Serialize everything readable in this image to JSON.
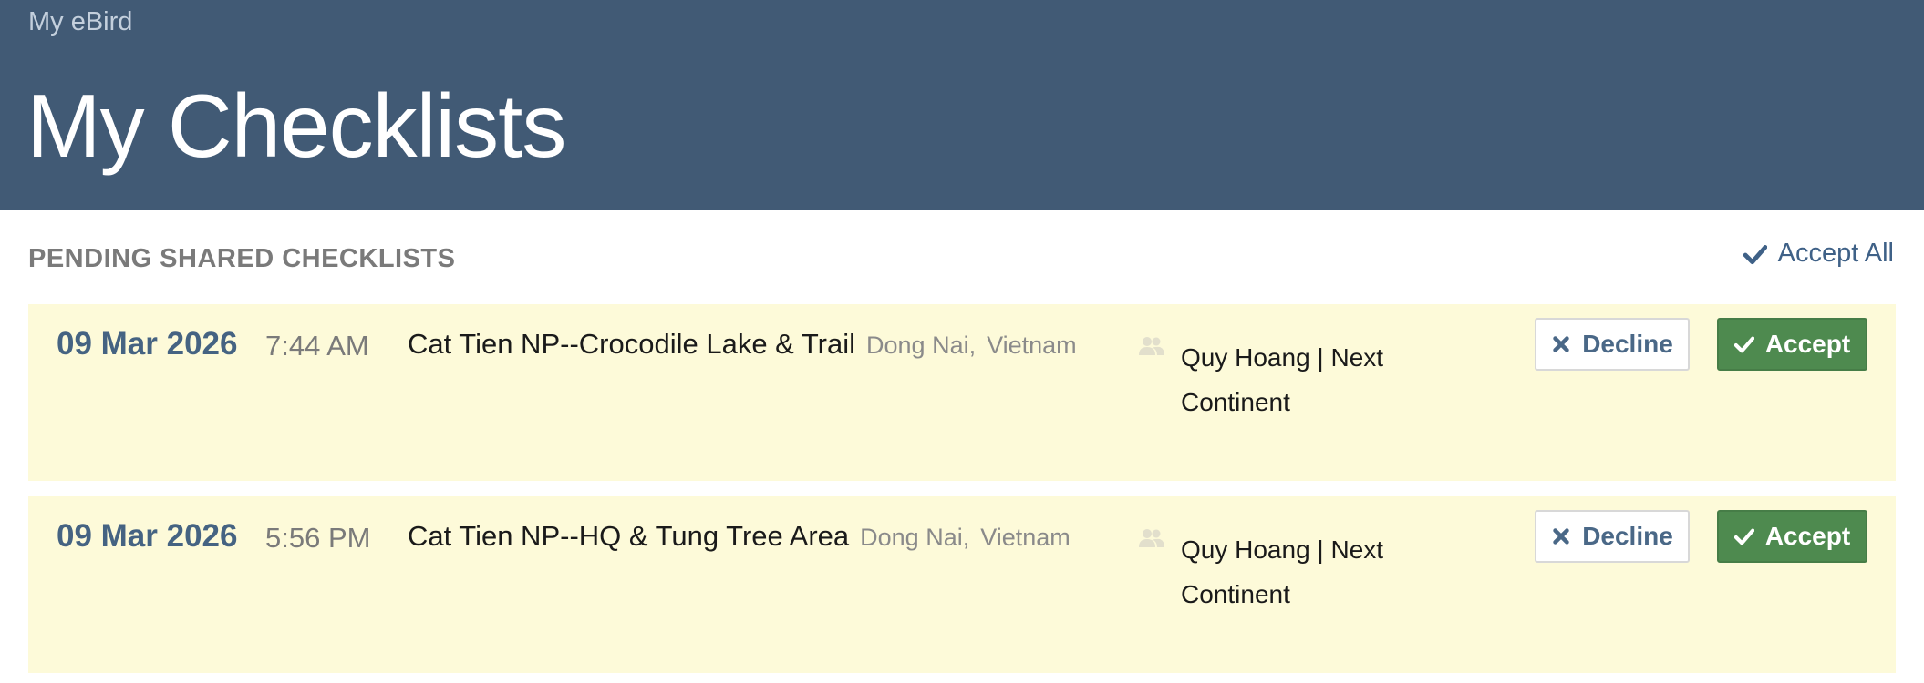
{
  "header": {
    "breadcrumb": "My eBird",
    "title": "My Checklists"
  },
  "section": {
    "title": "PENDING SHARED CHECKLISTS",
    "accept_all_label": "Accept All"
  },
  "checklists": [
    {
      "date": "09 Mar 2026",
      "time": "7:44 AM",
      "location": "Cat Tien NP--Crocodile Lake & Trail",
      "region": "Dong Nai,",
      "country": "Vietnam",
      "shared_by": "Quy Hoang | Next Continent",
      "decline_label": "Decline",
      "accept_label": "Accept"
    },
    {
      "date": "09 Mar 2026",
      "time": "5:56 PM",
      "location": "Cat Tien NP--HQ & Tung Tree Area",
      "region": "Dong Nai,",
      "country": "Vietnam",
      "shared_by": "Quy Hoang | Next Continent",
      "decline_label": "Decline",
      "accept_label": "Accept"
    }
  ],
  "colors": {
    "header_bg": "#415a75",
    "row_bg": "#fdfad9",
    "accept_green": "#4e8a4f",
    "link_blue": "#3f6187"
  },
  "icons": {
    "accept_all": "checkmark-icon",
    "decline": "x-icon",
    "accept": "checkmark-icon",
    "shared_by": "people-icon"
  }
}
